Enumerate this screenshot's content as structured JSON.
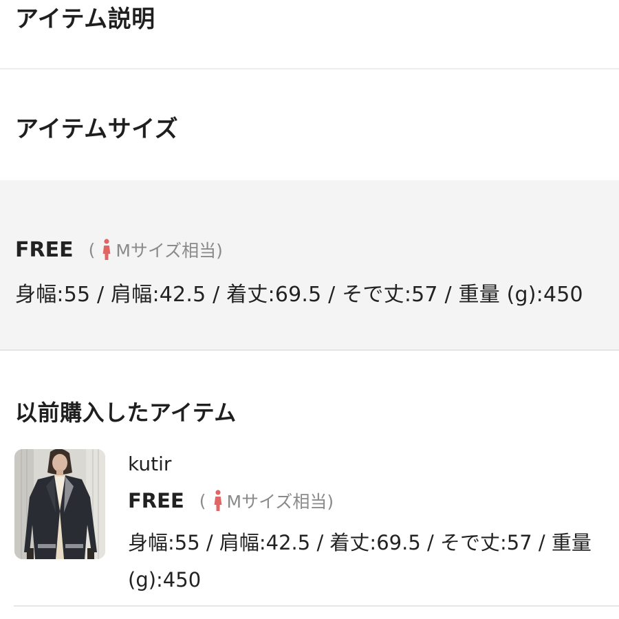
{
  "item_description": {
    "title": "アイテム説明"
  },
  "item_size": {
    "title": "アイテムサイズ",
    "size_name": "FREE",
    "size_equiv_open": "(",
    "size_equiv_text": "Mサイズ相当)",
    "specs": "身幅:55 / 肩幅:42.5 / 着丈:69.5 / そで丈:57 / 重量 (g):450",
    "icon": "person-icon",
    "icon_color": "#e06666"
  },
  "purchased_items": {
    "title": "以前購入したアイテム",
    "items": [
      {
        "brand": "kutir",
        "size_name": "FREE",
        "size_equiv_open": "(",
        "size_equiv_text": "Mサイズ相当)",
        "specs": "身幅:55 / 肩幅:42.5 / 着丈:69.5 / そで丈:57 / 重量 (g):450"
      }
    ]
  }
}
